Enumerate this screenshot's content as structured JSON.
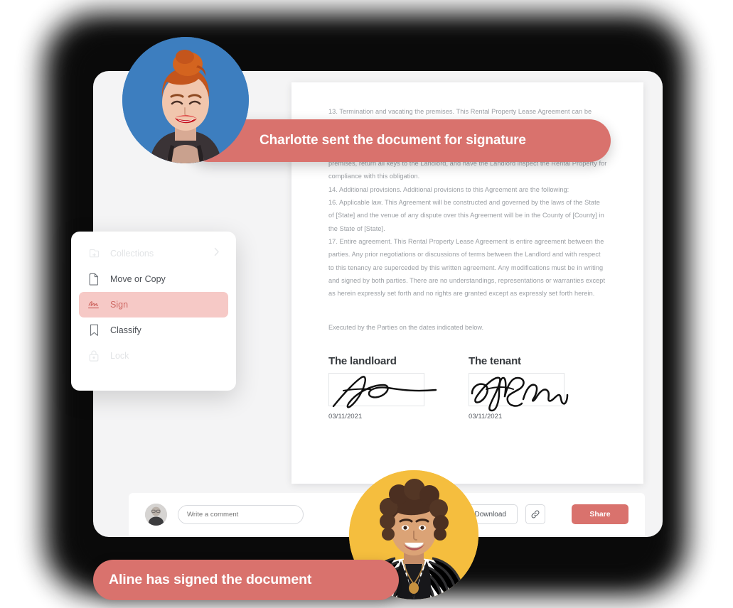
{
  "document": {
    "paragraphs": [
      "13. Termination and vacating the premises.  This Rental Property Lease Agreement can be terminated on 30-day advance written notice by either party.  If Tenant fails to comply with the terms of this Agreement, Landlord may terminate this tenancy following the notice procedures required by law.  Upon termination of this tenancy, Tenant will promptly vacate and clean the premises, return all keys to the Landlord, and have the Landlord inspect the Rental Property for compliance with this obligation.",
      "14. Additional provisions.  Additional provisions to this Agreement are the following:",
      "16. Applicable law.  This Agreement will be constructed and governed by the laws of the State of [State] and the venue of any dispute over this Agreement will be in the County of [County] in the State of [State].",
      "17. Entire agreement.  This Rental Property Lease Agreement is entire agreement between the parties.  Any prior negotiations or discussions of terms between the Landlord and with respect to this tenancy are superceded by this written agreement. Any modifications must be in writing and signed by both parties. There are no understandings, representations or warranties except as herein expressly set forth and no rights are granted except as expressly set forth herein."
    ],
    "executed_line": "Executed by the Parties on the dates indicated below.",
    "signatures": [
      {
        "title": "The landloard",
        "date": "03/11/2021"
      },
      {
        "title": "The tenant",
        "date": "03/11/2021"
      }
    ]
  },
  "menu": {
    "items": [
      {
        "label": "Collections",
        "icon": "collections-icon",
        "state": "disabled",
        "has_submenu": true
      },
      {
        "label": "Move or Copy",
        "icon": "file-icon",
        "state": "normal",
        "has_submenu": false
      },
      {
        "label": "Sign",
        "icon": "signature-icon",
        "state": "active",
        "has_submenu": false
      },
      {
        "label": "Classify",
        "icon": "bookmark-icon",
        "state": "normal",
        "has_submenu": false
      },
      {
        "label": "Lock",
        "icon": "lock-icon",
        "state": "disabled",
        "has_submenu": false
      }
    ]
  },
  "toolbar": {
    "comment_placeholder": "Write a comment",
    "comment_value": "",
    "download_label": "Download",
    "link_icon": "link-icon",
    "share_label": "Share"
  },
  "notifications": [
    {
      "text": "Charlotte sent the document for signature",
      "avatar": "charlotte-avatar",
      "avatar_bg": "#3d7ebf"
    },
    {
      "text": "Aline has signed the document",
      "avatar": "aline-avatar",
      "avatar_bg": "#f5be3e"
    }
  ],
  "colors": {
    "accent": "#d9726d",
    "accent_soft": "#f6c9c6",
    "window_bg": "#f4f4f5",
    "page_bg": "#ffffff",
    "blue_avatar": "#3d7ebf",
    "yellow_avatar": "#f5be3e"
  }
}
